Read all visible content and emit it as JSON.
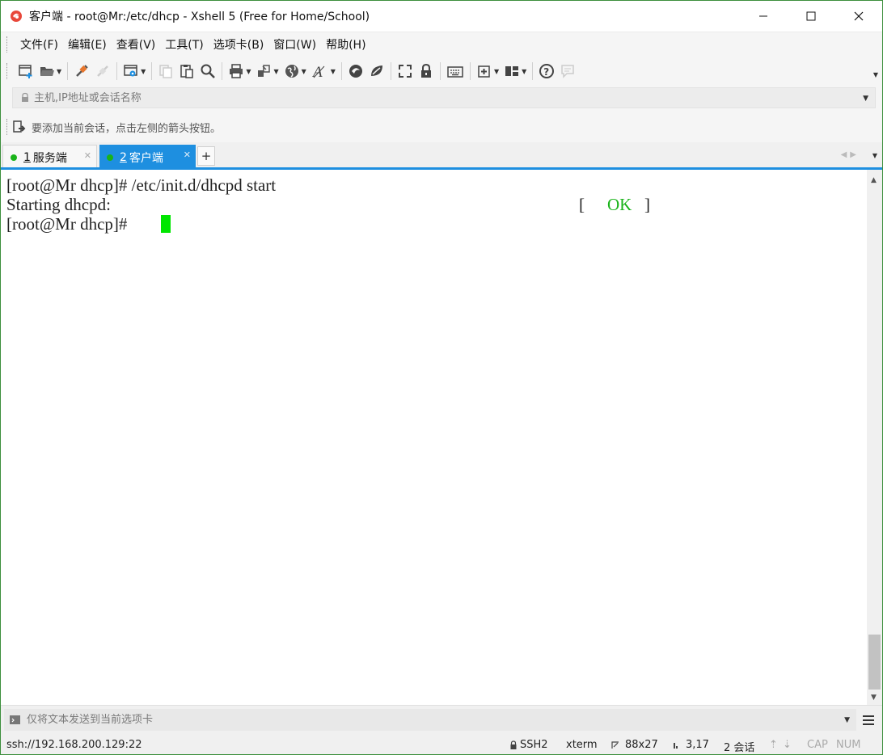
{
  "window": {
    "title": "客户端 - root@Mr:/etc/dhcp - Xshell 5 (Free for Home/School)",
    "minimize_label": "—",
    "maximize_label": "☐",
    "close_label": "✕"
  },
  "menu": {
    "items": [
      {
        "label": "文件(F)"
      },
      {
        "label": "编辑(E)"
      },
      {
        "label": "查看(V)"
      },
      {
        "label": "工具(T)"
      },
      {
        "label": "选项卡(B)"
      },
      {
        "label": "窗口(W)"
      },
      {
        "label": "帮助(H)"
      }
    ]
  },
  "address": {
    "placeholder": "主机,IP地址或会话名称"
  },
  "hint": {
    "text": "要添加当前会话，点击左侧的箭头按钮。"
  },
  "tabs": [
    {
      "number": "1",
      "label": "服务端",
      "status_color": "#19b319"
    },
    {
      "number": "2",
      "label": "客户端",
      "status_color": "#19b319"
    }
  ],
  "tab_add_label": "+",
  "terminal": {
    "lines": [
      "[root@Mr dhcp]# /etc/init.d/dhcpd start",
      "Starting dhcpd:",
      "[root@Mr dhcp]# "
    ],
    "ok_open": "[",
    "ok_text": "OK",
    "ok_close": "]",
    "ok_color": "#19b319",
    "cursor_color": "#00e600"
  },
  "compose": {
    "placeholder": "仅将文本发送到当前选项卡"
  },
  "status": {
    "connection": "ssh://192.168.200.129:22",
    "protocol": "SSH2",
    "terminal_type": "xterm",
    "size": "88x27",
    "cursor_pos": "3,17",
    "sessions": "2 会话",
    "cap": "CAP",
    "num": "NUM"
  },
  "colors": {
    "accent": "#1e8fe0",
    "window_border": "#3c8f3c"
  }
}
